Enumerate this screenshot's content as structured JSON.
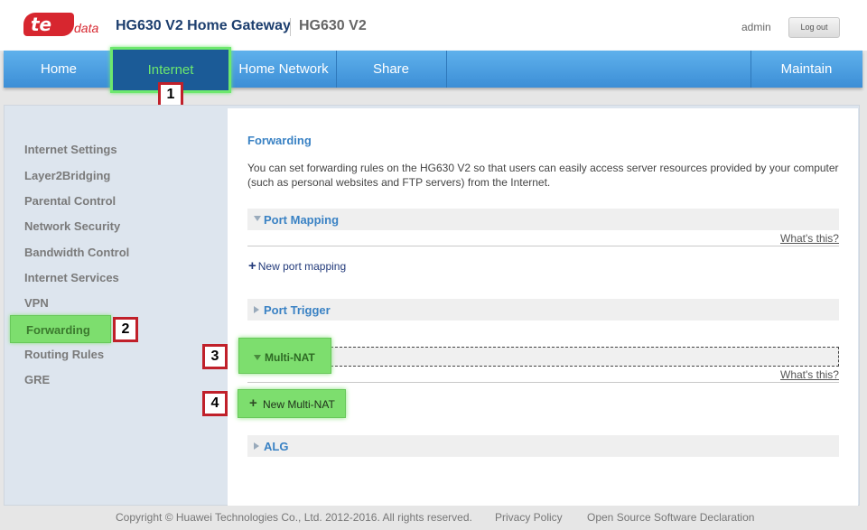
{
  "header": {
    "logo_text": "te",
    "logo_suffix": "data",
    "gateway_title": "HG630 V2 Home Gateway",
    "model": "HG630 V2",
    "user": "admin",
    "logout_label": "Log out"
  },
  "nav": {
    "home": "Home",
    "internet": "Internet",
    "home_network": "Home Network",
    "share": "Share",
    "maintain": "Maintain"
  },
  "steps": {
    "s1": "1",
    "s2": "2",
    "s3": "3",
    "s4": "4"
  },
  "sidebar": {
    "items": [
      "Internet Settings",
      "Layer2Bridging",
      "Parental Control",
      "Network Security",
      "Bandwidth Control",
      "Internet Services",
      "VPN",
      "Forwarding",
      "Routing Rules",
      "GRE"
    ]
  },
  "content": {
    "title": "Forwarding",
    "description": "You can set forwarding rules on the HG630 V2 so that users can easily access server resources provided by your computer (such as personal websites and FTP servers) from the Internet.",
    "port_mapping": "Port Mapping",
    "whats_this": "What's this?",
    "new_port_mapping": "New port mapping",
    "port_trigger": "Port Trigger",
    "multi_nat": "Multi-NAT",
    "new_multi_nat": "New Multi-NAT",
    "alg": "ALG"
  },
  "footer": {
    "copyright": "Copyright © Huawei Technologies Co., Ltd. 2012-2016. All rights reserved.",
    "privacy": "Privacy Policy",
    "open_source": "Open Source Software Declaration"
  },
  "colors": {
    "nav_blue": "#3c8ed6",
    "highlight_green": "#7dde6e",
    "marker_red": "#c0202a",
    "link_blue": "#3a82c4"
  }
}
